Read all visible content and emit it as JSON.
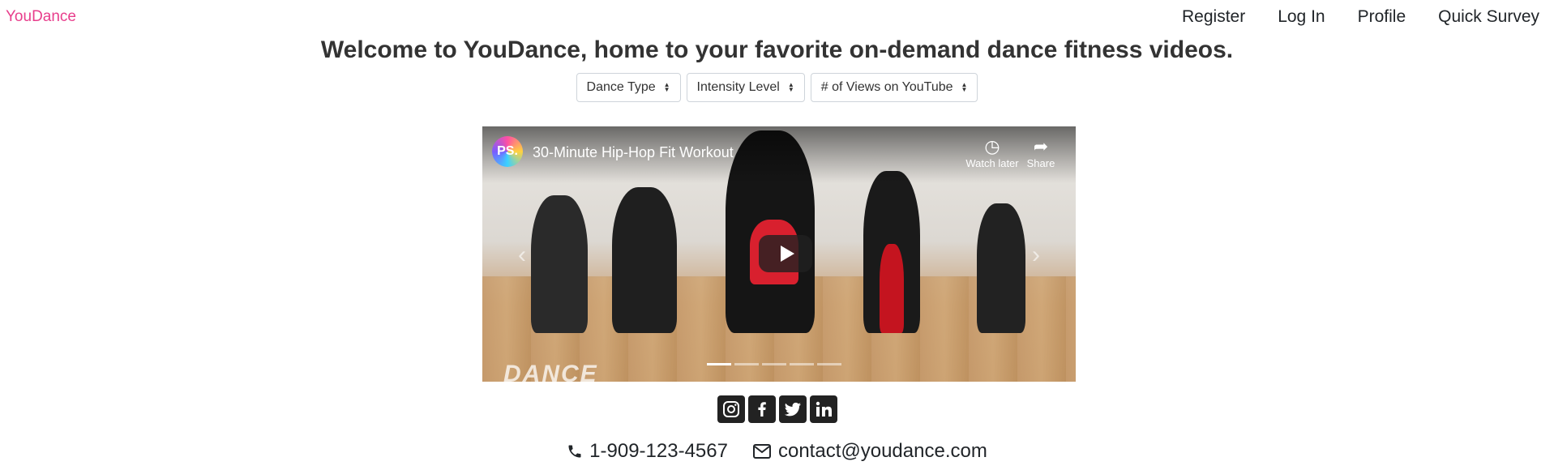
{
  "brand": "YouDance",
  "nav": {
    "items": [
      "Register",
      "Log In",
      "Profile",
      "Quick Survey"
    ]
  },
  "headline": "Welcome to YouDance, home to your favorite on-demand dance fitness videos.",
  "filters": [
    {
      "label": "Dance Type"
    },
    {
      "label": "Intensity Level"
    },
    {
      "label": "# of Views on YouTube"
    }
  ],
  "video": {
    "channel_initials": "PS.",
    "title": "30-Minute Hip-Hop Fit Workout",
    "watch_later_label": "Watch later",
    "share_label": "Share",
    "watermark": "DANCE",
    "carousel_slide_count": 5,
    "active_slide": 1
  },
  "social": [
    "instagram-icon",
    "facebook-icon",
    "twitter-icon",
    "linkedin-icon"
  ],
  "contact": {
    "phone": "1-909-123-4567",
    "email": "contact@youdance.com"
  },
  "colors": {
    "brand": "#e83e8c",
    "text": "#212529",
    "icon_bg": "#222222"
  }
}
